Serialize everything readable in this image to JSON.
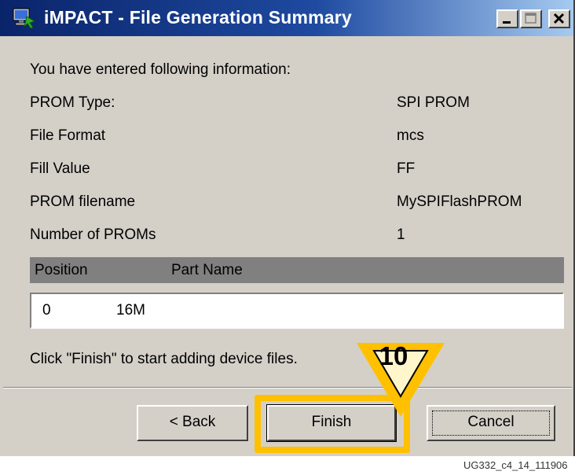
{
  "window": {
    "title": "iMPACT - File Generation Summary",
    "icon": "impact-app-icon",
    "controls": [
      "minimize-icon",
      "maximize-icon",
      "close-icon"
    ]
  },
  "intro": "You have entered following information:",
  "fields": [
    {
      "label": "PROM Type:",
      "value": "SPI PROM"
    },
    {
      "label": "File Format",
      "value": "mcs"
    },
    {
      "label": "Fill Value",
      "value": "FF"
    },
    {
      "label": "PROM filename",
      "value": "MySPIFlashPROM"
    },
    {
      "label": "Number of PROMs",
      "value": "1"
    }
  ],
  "table": {
    "columns": [
      "Position",
      "Part Name"
    ],
    "rows": [
      [
        "0",
        "16M"
      ]
    ]
  },
  "instruction": "Click \"Finish\" to start adding device files.",
  "buttons": {
    "back": "< Back",
    "finish": "Finish",
    "cancel": "Cancel"
  },
  "callout": {
    "step": "10"
  },
  "figure_id": "UG332_c4_14_111906",
  "colors": {
    "titlebar_start": "#0a246a",
    "titlebar_end": "#a6caf0",
    "dialog_bg": "#d4d0c8",
    "header_bg": "#808080",
    "highlight": "#ffc000"
  }
}
